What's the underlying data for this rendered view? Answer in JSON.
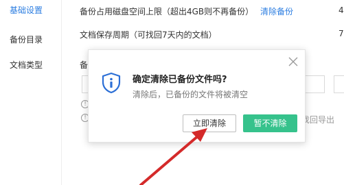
{
  "sidebar": {
    "items": [
      {
        "label": "基础设置"
      },
      {
        "label": "备份目录"
      },
      {
        "label": "文档类型"
      }
    ]
  },
  "settings": {
    "disk_limit_label": "备份占用磁盘空间上限（超出4GB则不再备份）",
    "disk_limit_link": "清除备份",
    "disk_limit_value_partial": "4",
    "retention_label": "文档保存周期（可找回7天内的文档）",
    "retention_value_partial": "7",
    "backup_label_partial": "备",
    "hint_partial": "找回导出"
  },
  "dialog": {
    "title": "确定清除已备份文件吗?",
    "message": "清除后，已备份的文件将被清空",
    "clear_button": "立即清除",
    "keep_button": "暂不清除",
    "accent_color": "#36c28c",
    "icon": "shield-info-icon"
  },
  "annotation": {
    "color": "#d42a2a",
    "icon": "arrow-annotation"
  }
}
